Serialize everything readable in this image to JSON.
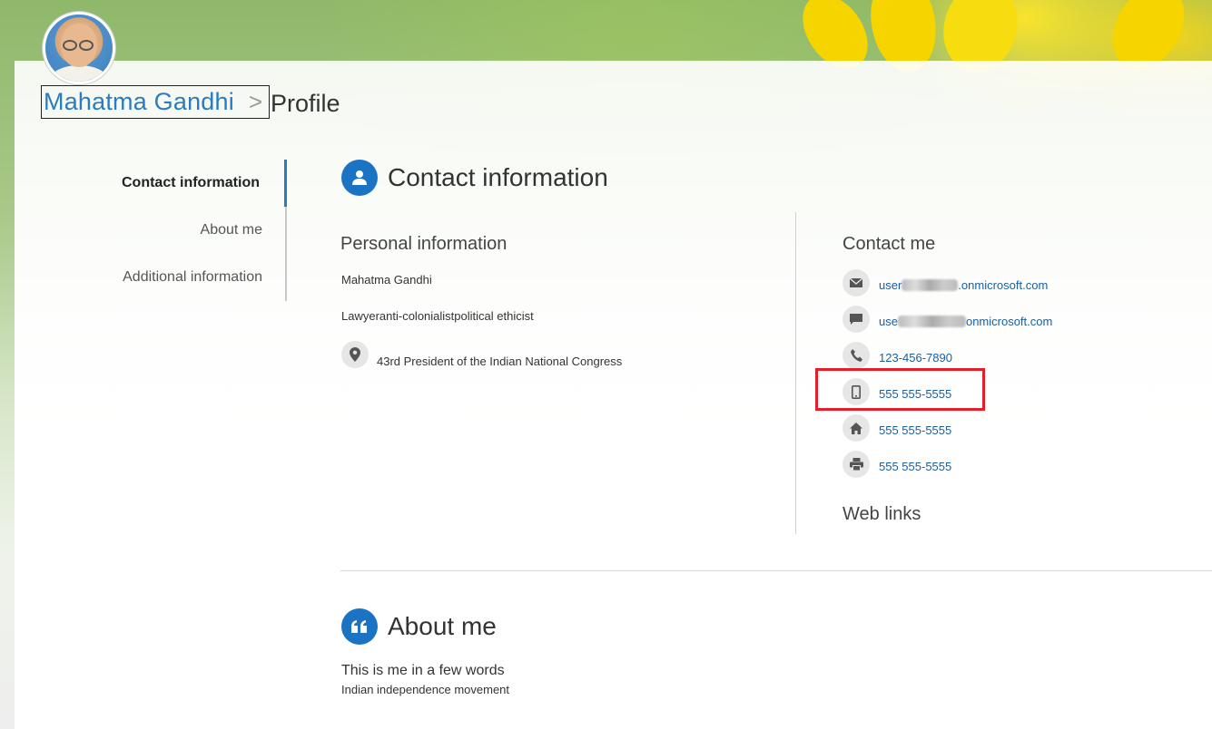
{
  "header": {
    "profile_name": "Mahatma Gandhi",
    "separator": ">",
    "page": "Profile"
  },
  "sidenav": {
    "items": [
      {
        "label": "Contact information",
        "active": true
      },
      {
        "label": "About me",
        "active": false
      },
      {
        "label": "Additional information",
        "active": false
      }
    ]
  },
  "contact_section": {
    "title": "Contact information",
    "icon": "person-icon",
    "personal": {
      "heading": "Personal information",
      "name": "Mahatma Gandhi",
      "job_title": "Lawyeranti-colonialistpolitical ethicist",
      "office": "43rd President of the Indian National Congress"
    },
    "contact_me": {
      "heading": "Contact me",
      "email_prefix": "user",
      "email_suffix": ".onmicrosoft.com",
      "im_prefix": "use",
      "im_suffix": "onmicrosoft.com",
      "work_phone": "123-456-7890",
      "mobile_phone": "555 555-5555",
      "home_phone": "555 555-5555",
      "fax": "555 555-5555"
    },
    "web_links_heading": "Web links"
  },
  "about_section": {
    "title": "About me",
    "icon": "quote-icon",
    "tagline": "This is me in a few words",
    "text": "Indian independence movement"
  },
  "colors": {
    "accent": "#1a73c3",
    "link": "#1a5fa0",
    "highlight": "#e0202a"
  }
}
